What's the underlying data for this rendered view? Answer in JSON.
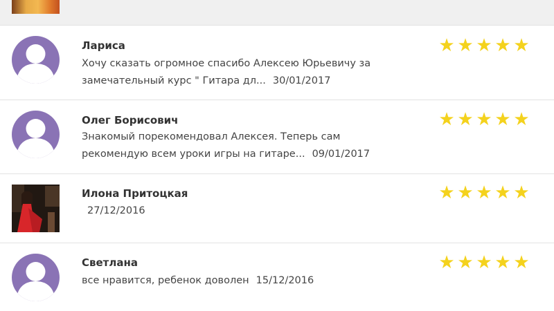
{
  "reviews": [
    {
      "name": "Лариса",
      "text_line1": "Хочу сказать огромное спасибо Алексею Юрьевичу за",
      "text_line2": "замечательный курс \" Гитара дл...",
      "date": "30/01/2017",
      "rating": 5,
      "avatar": "user-avatar-icon"
    },
    {
      "name": "Олег Борисович",
      "text_line1": "Знакомый порекомендовал Алексея. Теперь сам",
      "text_line2": "рекомендую всем уроки игры на гитаре...",
      "date": "09/01/2017",
      "rating": 5,
      "avatar": "user-avatar-icon"
    },
    {
      "name": "Илона Притоцкая",
      "date": "27/12/2016",
      "rating": 5,
      "avatar": "user-photo"
    },
    {
      "name": "Светлана",
      "text_line1": "все нравится, ребенок доволен",
      "date": "15/12/2016",
      "rating": 5,
      "avatar": "user-avatar-icon"
    }
  ],
  "colors": {
    "star": "#f4d21d",
    "avatar_bg": "#8a73b5",
    "avatar_figure": "#ffffff",
    "divider": "#e2e2e2"
  },
  "icons": {
    "star": "★"
  }
}
